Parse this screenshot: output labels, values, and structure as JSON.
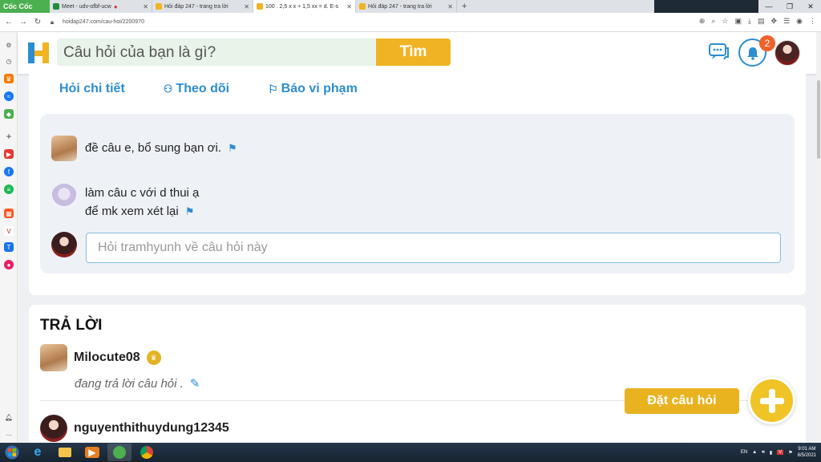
{
  "browser": {
    "brand": "Cốc Cốc",
    "tabs": [
      {
        "title": "Meet - udv-ofbf-ucw",
        "active": false
      },
      {
        "title": "Hỏi đáp 247 - trang tra lời",
        "active": false
      },
      {
        "title": "100 . 2,5 x x + 1,5 xx = d. E-s",
        "active": true
      },
      {
        "title": "Hỏi đáp 247 - trang tra lời",
        "active": false
      }
    ],
    "url": "hoidap247.com/cau-hoi/2200970"
  },
  "header": {
    "search_placeholder": "Câu hỏi của bạn là gì?",
    "search_button": "Tìm",
    "notification_count": "2"
  },
  "question": {
    "actions": [
      "Hỏi chi tiết",
      "Theo dõi",
      "Báo vi phạm"
    ],
    "comments": [
      {
        "lines": [
          "đề câu e,  bổ sung bạn ơi."
        ]
      },
      {
        "lines": [
          "làm câu c với d thui ạ",
          "để mk xem xét lại"
        ]
      }
    ],
    "comment_placeholder": "Hỏi tramhyunh về câu hỏi này"
  },
  "answers": {
    "heading": "TRẢ LỜI",
    "items": [
      {
        "username": "Milocute08",
        "status": "đang trả lời câu hỏi ."
      },
      {
        "username": "nguyenthithuydung12345"
      }
    ]
  },
  "ask_button": "Đặt câu hỏi",
  "taskbar": {
    "lang": "EN",
    "time": "9:01 AM",
    "date": "8/5/2021"
  },
  "colors": {
    "accent_blue": "#2c8dd0",
    "brand_yellow": "#f0b323",
    "search_bg": "#e8f3ea"
  }
}
